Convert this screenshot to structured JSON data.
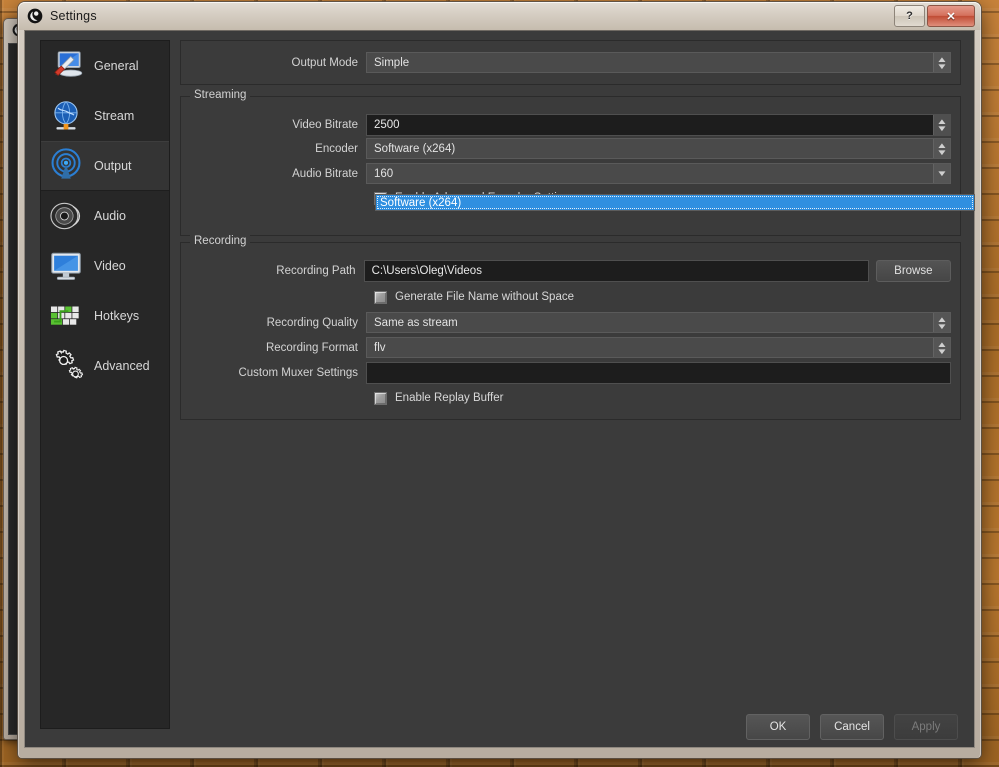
{
  "window": {
    "title": "Settings",
    "app_icon": "obs-logo-icon",
    "help_button": "?",
    "close_button": "✕"
  },
  "sidebar": {
    "items": [
      {
        "label": "General",
        "icon": "general-monitor-screwdriver-icon",
        "selected": false
      },
      {
        "label": "Stream",
        "icon": "stream-globe-icon",
        "selected": false
      },
      {
        "label": "Output",
        "icon": "output-broadcast-antenna-icon",
        "selected": true
      },
      {
        "label": "Audio",
        "icon": "audio-speaker-icon",
        "selected": false
      },
      {
        "label": "Video",
        "icon": "video-monitor-icon",
        "selected": false
      },
      {
        "label": "Hotkeys",
        "icon": "hotkeys-keyboard-icon",
        "selected": false
      },
      {
        "label": "Advanced",
        "icon": "advanced-gears-icon",
        "selected": false
      }
    ]
  },
  "main": {
    "output_mode": {
      "label": "Output Mode",
      "value": "Simple"
    },
    "streaming": {
      "title": "Streaming",
      "video_bitrate": {
        "label": "Video Bitrate",
        "value": "2500"
      },
      "encoder": {
        "label": "Encoder",
        "value": "Software (x264)"
      },
      "audio_bitrate": {
        "label": "Audio Bitrate",
        "value": "160"
      },
      "advanced_encoder": {
        "label": "Enable Advanced Encoder Settings",
        "checked": false
      }
    },
    "recording": {
      "title": "Recording",
      "recording_path": {
        "label": "Recording Path",
        "value": "C:\\Users\\Oleg\\Videos"
      },
      "browse_button": "Browse",
      "generate_no_space": {
        "label": "Generate File Name without Space",
        "checked": false
      },
      "recording_quality": {
        "label": "Recording Quality",
        "value": "Same as stream"
      },
      "recording_format": {
        "label": "Recording Format",
        "value": "flv"
      },
      "custom_muxer": {
        "label": "Custom Muxer Settings",
        "value": ""
      },
      "replay_buffer": {
        "label": "Enable Replay Buffer",
        "checked": false
      }
    }
  },
  "dropdown": {
    "open": true,
    "for_field": "Encoder",
    "items": [
      {
        "label": "Software (x264)",
        "highlighted": true
      }
    ]
  },
  "footer": {
    "ok": "OK",
    "cancel": "Cancel",
    "apply": "Apply",
    "apply_disabled": true
  },
  "colors": {
    "highlight_blue": "#2f8fe0",
    "panel_bg": "#3b3b3b",
    "sidebar_bg": "#272727",
    "field_bg": "#1d1d1d",
    "combo_bg": "#4a4a4a",
    "text": "#d8d8d8"
  }
}
